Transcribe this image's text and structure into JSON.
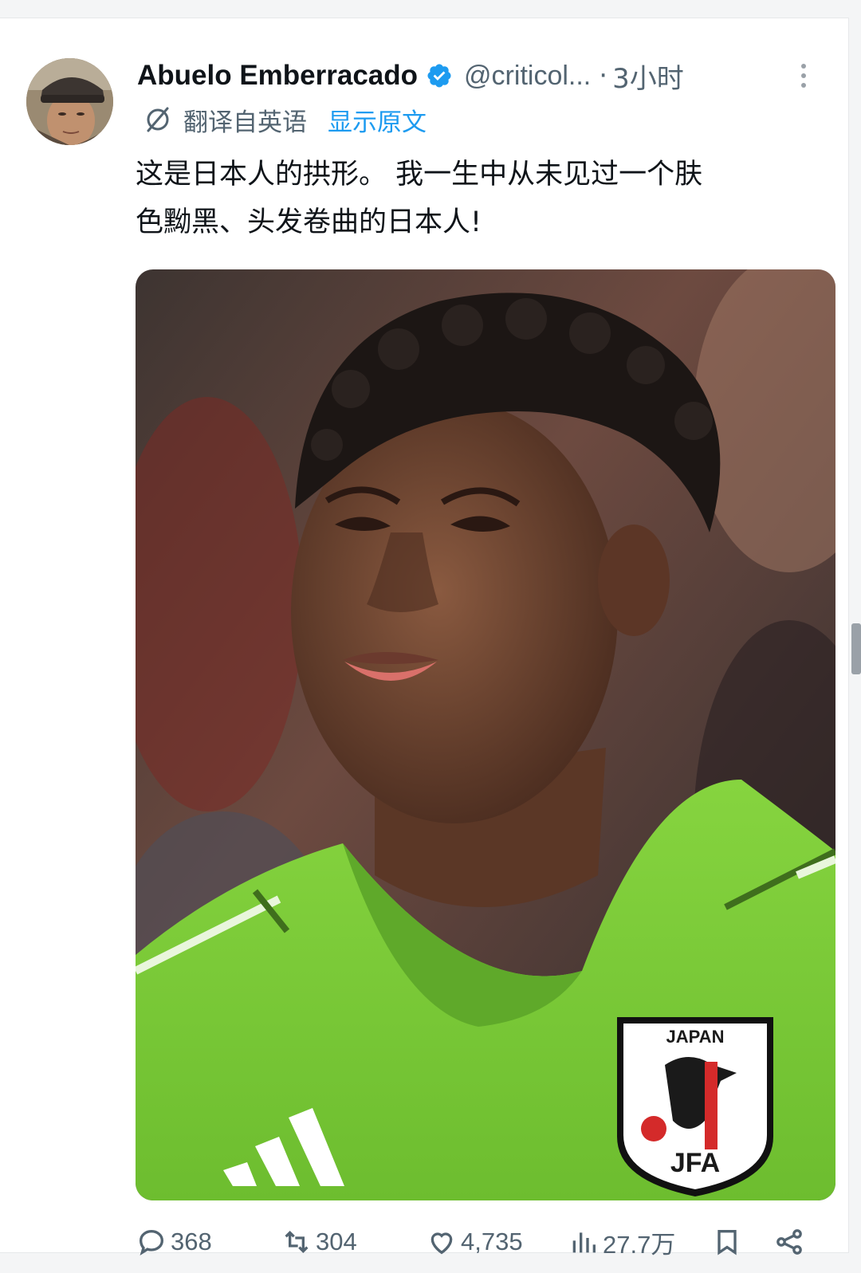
{
  "author": {
    "display_name": "Abuelo Emberracado",
    "handle": "@criticol...",
    "time_sep": "·",
    "time": "3小时"
  },
  "translation": {
    "translated_from": "翻译自英语",
    "show_original": "显示原文"
  },
  "tweet": {
    "lines": [
      "这是日本人的拱形。 我一生中从未见过一个肤",
      "色黝黑、头发卷曲的日本人!"
    ]
  },
  "media": {
    "badge_top": "JAPAN",
    "badge_bottom": "JFA",
    "jersey_color": "#7dcc3a"
  },
  "actions": {
    "replies": "368",
    "retweets": "304",
    "likes": "4,735",
    "views": "27.7万"
  },
  "colors": {
    "text_primary": "#0f1419",
    "text_secondary": "#536471",
    "accent": "#1d9bf0"
  },
  "icons": {
    "verified": "verified-badge-icon",
    "more": "more-options-icon",
    "translate": "translate-icon",
    "reply": "reply-icon",
    "retweet": "retweet-icon",
    "like": "like-icon",
    "views": "views-icon",
    "bookmark": "bookmark-icon",
    "share": "share-icon"
  }
}
